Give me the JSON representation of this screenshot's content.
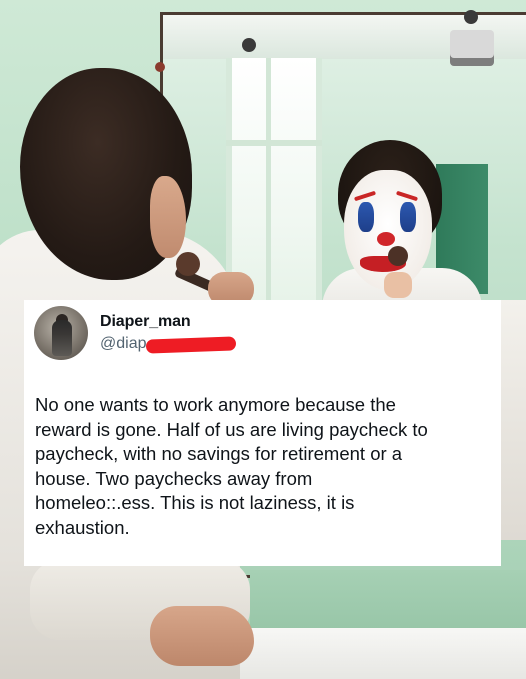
{
  "tweet": {
    "display_name": "Diaper_man",
    "handle_visible": "@diap",
    "text": "No one wants to work anymore because the\nreward is gone. Half of us are living paycheck to\npaycheck, with no savings for retirement or a\nhouse. Two paychecks away from\nhomeleo::.ess. This is not laziness, it is\nexhaustion."
  },
  "colors": {
    "redaction": "#ee1c24",
    "wall_green": "#b6dcc3",
    "text_primary": "#0f1419",
    "text_secondary": "#536471"
  },
  "icons": {
    "avatar": "profile-photo"
  }
}
